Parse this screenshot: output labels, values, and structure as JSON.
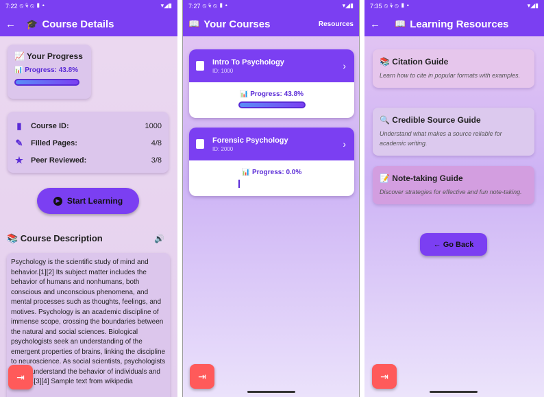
{
  "screen1": {
    "status_time": "7:22",
    "title": "Course Details",
    "progress": {
      "heading": "📈 Your Progress",
      "label": "📊 Progress: 43.8%",
      "value": 0.438
    },
    "stats": [
      {
        "icon": "bookmark-icon",
        "label": "Course ID:",
        "value": "1000"
      },
      {
        "icon": "page-edit-icon",
        "label": "Filled Pages:",
        "value": "4/8"
      },
      {
        "icon": "star-icon",
        "label": "Peer Reviewed:",
        "value": "3/8"
      }
    ],
    "start_button": "Start Learning",
    "description_heading": "📚 Course Description",
    "description_text": "Psychology is the scientific study of mind and behavior.[1][2] Its subject matter includes the behavior of humans and nonhumans, both conscious and unconscious phenomena, and mental processes such as thoughts, feelings, and motives. Psychology is an academic discipline of immense scope, crossing the boundaries between the natural and social sciences. Biological psychologists seek an understanding of the emergent properties of brains, linking the discipline to neuroscience. As social scientists, psychologists aim to understand the behavior of individuals and groups.[3][4] Sample text from wikipedia"
  },
  "screen2": {
    "status_time": "7:27",
    "title": "Your Courses",
    "resources_link": "Resources",
    "courses": [
      {
        "name": "Intro To Psychology",
        "id": "ID: 1000",
        "progress_label": "📊 Progress: 43.8%",
        "progress": 0.438
      },
      {
        "name": "Forensic Psychology",
        "id": "ID: 2000",
        "progress_label": "📊 Progress: 0.0%",
        "progress": 0.0
      }
    ]
  },
  "screen3": {
    "status_time": "7:35",
    "title": "Learning Resources",
    "guides": [
      {
        "title": "📚 Citation Guide",
        "desc": "Learn how to cite in popular formats with examples.",
        "color": "#e6c6ec"
      },
      {
        "title": "🔍 Credible Source Guide",
        "desc": "Understand what makes a source reliable for academic writing.",
        "color": "#dcc9ee"
      },
      {
        "title": "📝 Note-taking Guide",
        "desc": "Discover strategies for effective and fun note-taking.",
        "color": "#d39ee0"
      }
    ],
    "back_button": "← Go Back"
  },
  "colors": {
    "primary": "#7b3ff2",
    "fab": "#ff5a5a",
    "accent_text": "#5a2bd6"
  }
}
